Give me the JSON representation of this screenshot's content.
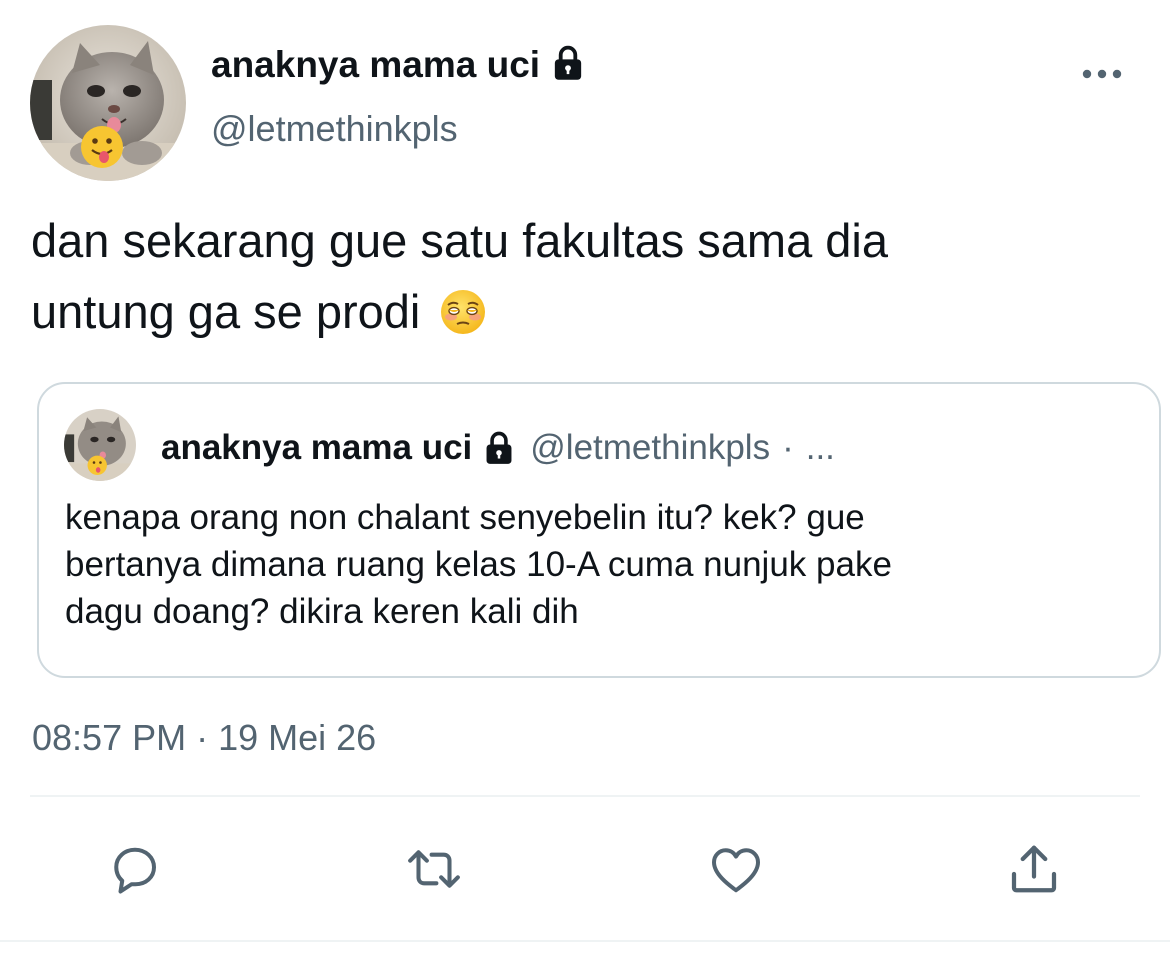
{
  "tweet": {
    "author": {
      "display_name": "anaknya mama uci",
      "handle": "@letmethinkpls",
      "protected_icon": "lock-icon",
      "avatar": "cat-avatar-with-tongue-emoji"
    },
    "more_icon": "more-options-icon",
    "text_lines": [
      "dan sekarang gue satu fakultas sama dia",
      "untung ga se prodi"
    ],
    "trailing_emoji": "pleading-face-emoji",
    "timestamp": {
      "time": "08:57 PM",
      "separator": "·",
      "date": "19 Mei 26"
    }
  },
  "quoted_tweet": {
    "display_name": "anaknya mama uci",
    "protected_icon": "lock-icon",
    "handle": "@letmethinkpls",
    "separator": "·",
    "time": "...",
    "text_lines": [
      "kenapa orang non chalant senyebelin itu? kek? gue",
      "bertanya dimana ruang kelas 10-A cuma nunjuk pake",
      "dagu doang? dikira keren kali dih"
    ]
  },
  "actions": [
    {
      "name": "reply",
      "icon": "reply-icon"
    },
    {
      "name": "retweet",
      "icon": "retweet-icon"
    },
    {
      "name": "like",
      "icon": "heart-icon"
    },
    {
      "name": "share",
      "icon": "share-icon"
    }
  ],
  "colors": {
    "text_primary": "#0f1419",
    "text_secondary": "#536471",
    "border": "#cfd9de",
    "icon": "#536471"
  }
}
